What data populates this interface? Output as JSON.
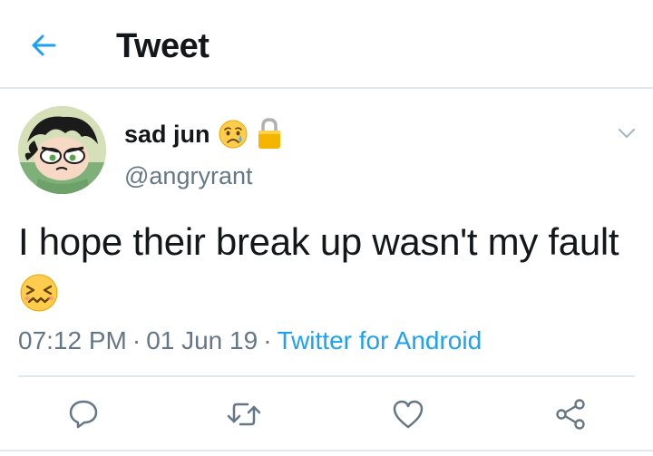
{
  "header": {
    "title": "Tweet",
    "back_icon": "arrow-left-icon",
    "accent_color": "#1da1f2"
  },
  "tweet": {
    "display_name": "sad jun",
    "name_emoji": "worried-face-with-tear-emoji",
    "protected_icon": "lock-icon",
    "handle": "@angryrant",
    "text": "I hope their break up wasn't my fault",
    "text_emoji": "confounded-face-emoji",
    "time": "07:12 PM",
    "separator": "·",
    "date": "01 Jun 19",
    "source": "Twitter for Android",
    "more_icon": "chevron-down-icon"
  },
  "actions": [
    {
      "name": "reply",
      "icon": "reply-icon"
    },
    {
      "name": "retweet",
      "icon": "retweet-icon"
    },
    {
      "name": "like",
      "icon": "heart-icon"
    },
    {
      "name": "share",
      "icon": "share-icon"
    }
  ],
  "colors": {
    "text_primary": "#14171a",
    "text_secondary": "#657786",
    "link": "#1da1f2",
    "divider": "#e1e8ed",
    "lock": "#f4b400"
  }
}
